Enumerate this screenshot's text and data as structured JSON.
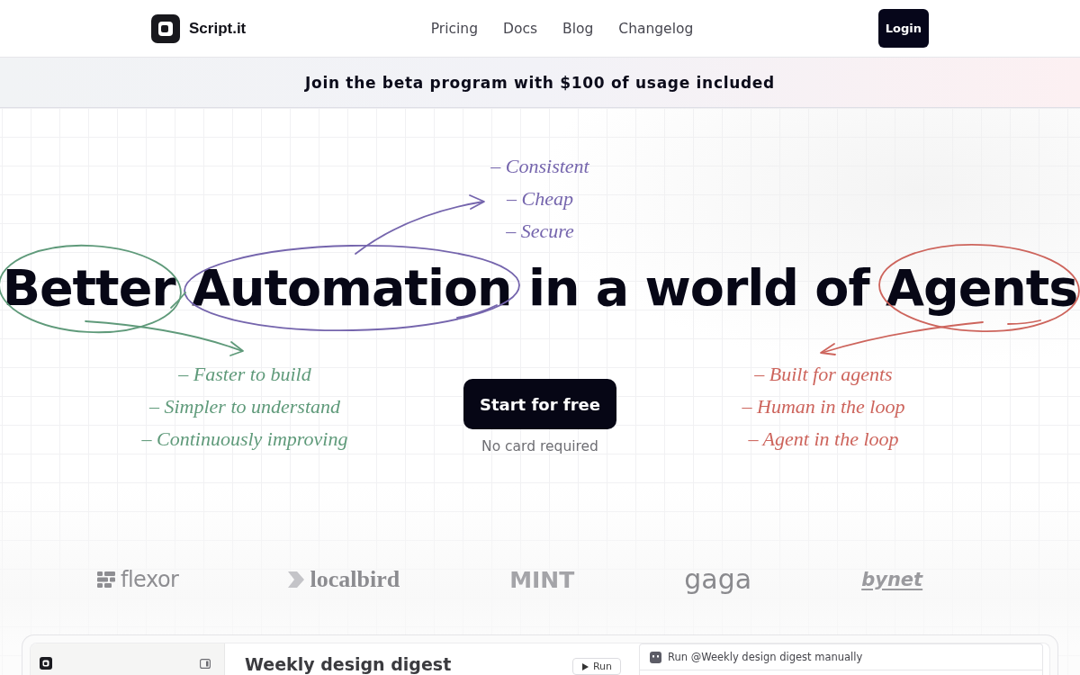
{
  "header": {
    "brand": "Script.it",
    "nav": [
      "Pricing",
      "Docs",
      "Blog",
      "Changelog"
    ],
    "login_button": "Login"
  },
  "banner": {
    "text": "Join the beta program with $100 of usage included"
  },
  "hero": {
    "headline": "Better Automation in a world of Agents",
    "annotations": [
      {
        "color": "#7565ad",
        "notes": [
          "– Consistent",
          "– Cheap",
          "– Secure"
        ]
      },
      {
        "color": "#5f9a7a",
        "notes": [
          "– Faster to build",
          "– Simpler to understand",
          "– Continuously improving"
        ]
      },
      {
        "color": "#cd645c",
        "notes": [
          "– Built for agents",
          "– Human in the loop",
          "– Agent in the loop"
        ]
      }
    ],
    "cta_button": "Start for free",
    "cta_note": "No card required"
  },
  "logos": [
    {
      "kind": "blocks",
      "name": "flexor"
    },
    {
      "kind": "chevron",
      "name": "localbird"
    },
    {
      "kind": "stencil",
      "name": "MINT"
    },
    {
      "kind": "light",
      "name": "gaga"
    },
    {
      "kind": "underlined",
      "name": "bynet"
    }
  ],
  "app_preview": {
    "title": "Weekly design digest",
    "run_button": "Run",
    "panel_title": "Run @Weekly design digest manually"
  }
}
